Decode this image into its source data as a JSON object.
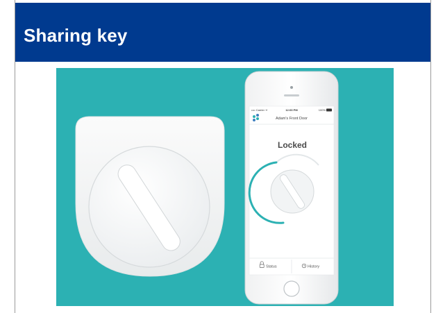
{
  "slide": {
    "title": "Sharing key"
  },
  "photo": {
    "background_color": "#2cb1b3",
    "phone": {
      "status_bar": {
        "carrier": "•••• Carrier ᯤ",
        "time": "12:00 PM",
        "battery": "100%"
      },
      "lock_name": "Adam's Front Door",
      "lock_state": "Locked",
      "tabs": {
        "status": "Status",
        "history": "History"
      },
      "icons": [
        "app-logo-icon",
        "padlock-icon",
        "clock-icon"
      ]
    }
  }
}
